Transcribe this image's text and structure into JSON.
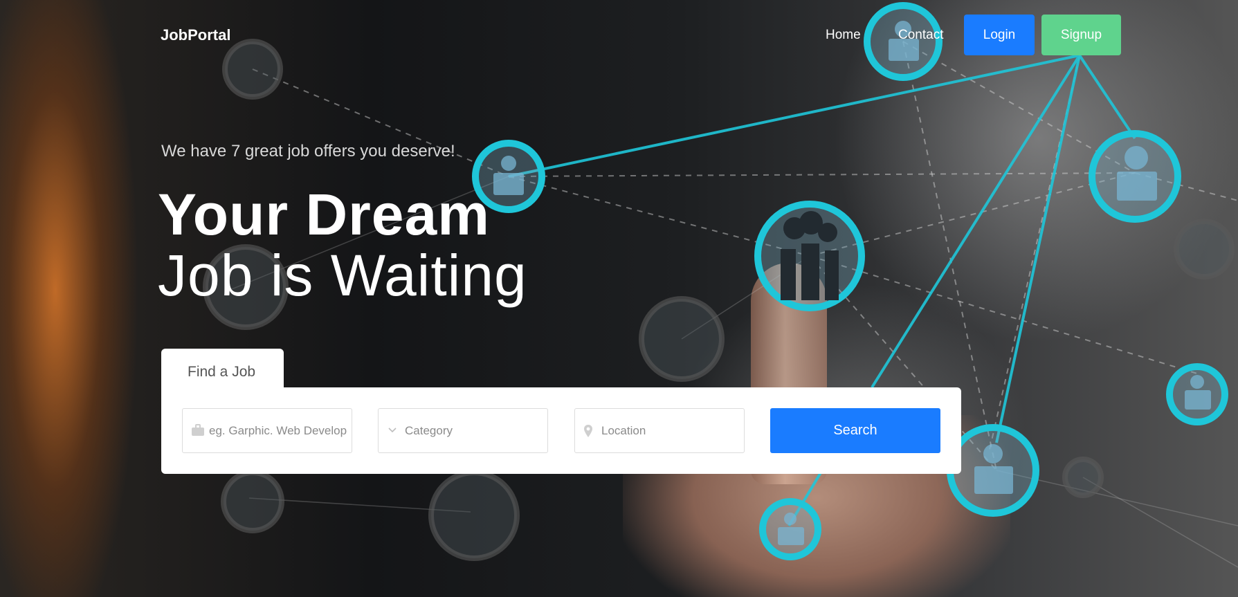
{
  "brand": "JobPortal",
  "nav": {
    "home": "Home",
    "contact": "Contact",
    "login": "Login",
    "signup": "Signup"
  },
  "hero": {
    "tagline": "We have 7 great job offers you deserve!",
    "headline_line1": "Your Dream",
    "headline_line2": "Job is Waiting"
  },
  "search": {
    "tab_label": "Find a Job",
    "keyword_placeholder": "eg. Garphic. Web Developer",
    "category_placeholder": "Category",
    "location_placeholder": "Location",
    "button_label": "Search"
  },
  "colors": {
    "primary": "#1a7cff",
    "signup": "#5fd38d",
    "network_glow": "#1fc6d9"
  }
}
